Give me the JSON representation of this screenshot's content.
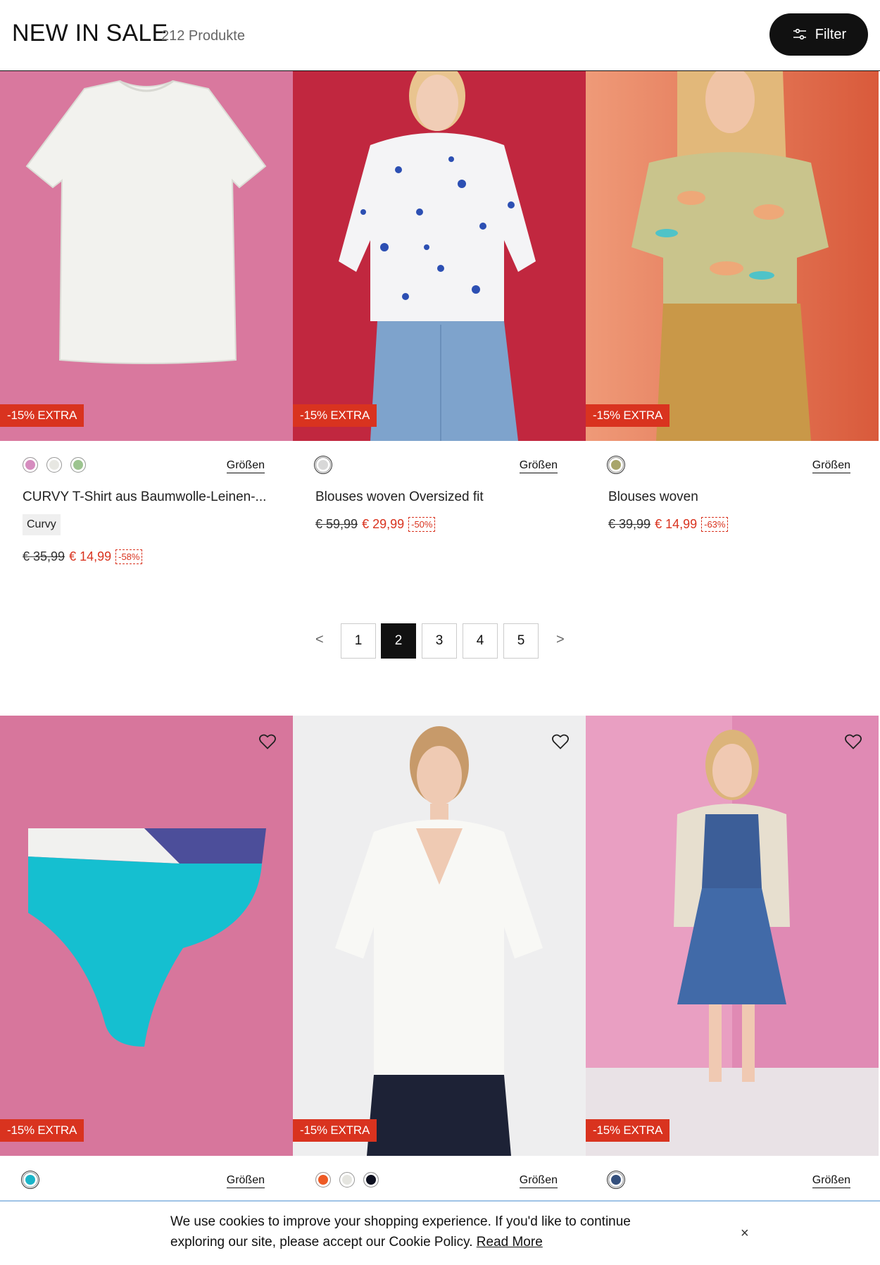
{
  "header": {
    "title": "NEW IN SALE",
    "count": "212 Produkte",
    "filter_label": "Filter"
  },
  "products_top": [
    {
      "badge": "-15% EXTRA",
      "sizes_label": "Größen",
      "name": "CURVY T-Shirt aus Baumwolle-Leinen-...",
      "tag": "Curvy",
      "old_price": "€ 35,99",
      "new_price": "€ 14,99",
      "discount": "-58%",
      "swatches": [
        "#d68cbf",
        "#e7e7e2",
        "#9cc48f"
      ],
      "image_desc": "white t-shirt on pink background"
    },
    {
      "badge": "-15% EXTRA",
      "sizes_label": "Größen",
      "name": "Blouses woven Oversized fit",
      "old_price": "€ 59,99",
      "new_price": "€ 29,99",
      "discount": "-50%",
      "swatches": [
        "#d8d8d8"
      ]
    },
    {
      "badge": "-15% EXTRA",
      "sizes_label": "Größen",
      "name": "Blouses woven",
      "old_price": "€ 39,99",
      "new_price": "€ 14,99",
      "discount": "-63%",
      "swatches": [
        "#a8a66a"
      ]
    }
  ],
  "pagination": {
    "prev": "<",
    "next": ">",
    "pages": [
      "1",
      "2",
      "3",
      "4",
      "5"
    ],
    "active": "2"
  },
  "products_bottom": [
    {
      "badge": "-15% EXTRA",
      "sizes_label": "Größen",
      "swatches": [
        "#1ab5c9"
      ]
    },
    {
      "badge": "-15% EXTRA",
      "sizes_label": "Größen",
      "swatches": [
        "#ee5a24",
        "#e5e5e0",
        "#0d1020"
      ]
    },
    {
      "badge": "-15% EXTRA",
      "sizes_label": "Größen",
      "swatches": [
        "#34507d"
      ]
    }
  ],
  "cookie": {
    "text": "We use cookies to improve your shopping experience. If you'd like to continue exploring our site, please accept our Cookie Policy.",
    "link": "Read More",
    "close": "×"
  },
  "colors": {
    "sale_red": "#d9331f",
    "black": "#111111"
  }
}
